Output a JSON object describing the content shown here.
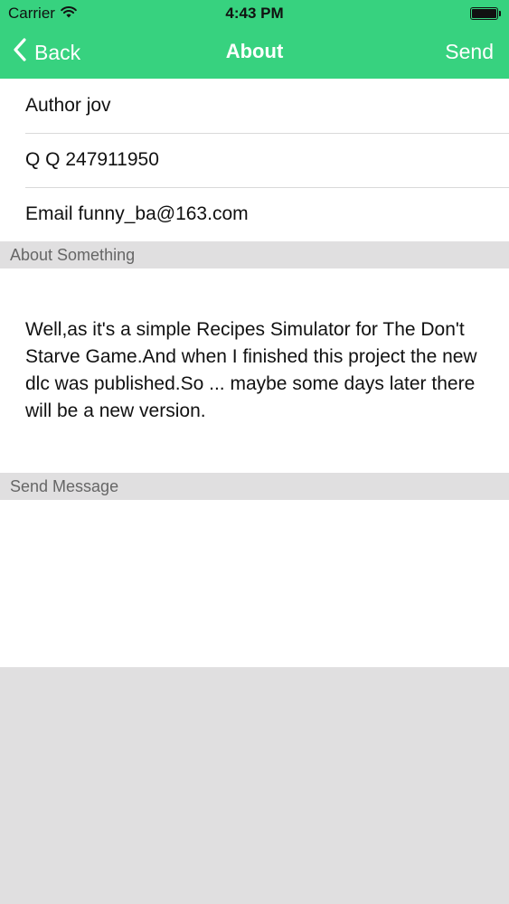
{
  "status_bar": {
    "carrier": "Carrier",
    "time": "4:43 PM"
  },
  "nav": {
    "back_label": "Back",
    "title": "About",
    "send_label": "Send"
  },
  "info_rows": [
    {
      "text": "Author jov"
    },
    {
      "text": "Q Q 247911950"
    },
    {
      "text": "Email funny_ba@163.com"
    }
  ],
  "about_section": {
    "header": "About Something",
    "body": "Well,as it's a simple Recipes Simulator for The Don't Starve Game.And when I finished this project the new dlc was published.So ... maybe some days later there will be a new version."
  },
  "message_section": {
    "header": "Send Message",
    "value": ""
  },
  "colors": {
    "accent": "#37d27f",
    "background": "#e0dfe0"
  },
  "icons": {
    "wifi": "wifi-icon",
    "battery": "battery-icon",
    "back": "chevron-left-icon"
  }
}
